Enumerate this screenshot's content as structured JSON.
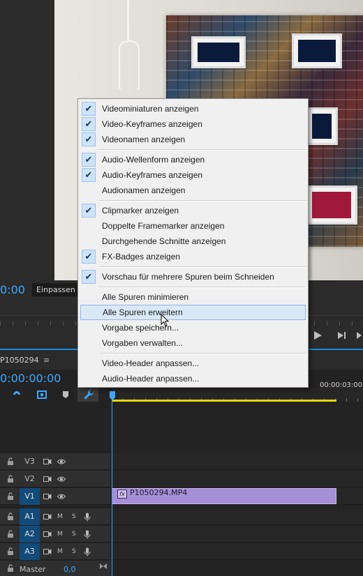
{
  "monitor": {
    "timecode": "0:00",
    "fit_label": "Einpassen"
  },
  "timeline": {
    "sequence_name": "P1050294",
    "sequence_menu_glyph": "≡",
    "timecode": "0:00:00:00",
    "ruler_end_label": "00:00:03:00",
    "tracks": {
      "video": [
        {
          "label": "V3",
          "active": false
        },
        {
          "label": "V2",
          "active": false
        },
        {
          "label": "V1",
          "active": true
        }
      ],
      "audio": [
        {
          "label": "A1",
          "m": "M",
          "s": "S",
          "active": true
        },
        {
          "label": "A2",
          "m": "M",
          "s": "S",
          "active": true
        },
        {
          "label": "A3",
          "m": "M",
          "s": "S",
          "active": true
        }
      ]
    },
    "clip": {
      "name": "P1050294.MP4",
      "fx_badge": "fx",
      "color": "#a58fd6"
    },
    "master": {
      "label": "Master",
      "value": "0,0"
    }
  },
  "context_menu": {
    "items": [
      {
        "label": "Videominiaturen anzeigen",
        "checked": true
      },
      {
        "label": "Video-Keyframes anzeigen",
        "checked": true
      },
      {
        "label": "Videonamen anzeigen",
        "checked": true
      },
      {
        "label": "Audio-Wellenform anzeigen",
        "checked": true
      },
      {
        "label": "Audio-Keyframes anzeigen",
        "checked": true
      },
      {
        "label": "Audionamen anzeigen",
        "checked": false
      },
      {
        "label": "Clipmarker anzeigen",
        "checked": true
      },
      {
        "label": "Doppelte Framemarker anzeigen",
        "checked": false
      },
      {
        "label": "Durchgehende Schnitte anzeigen",
        "checked": false
      },
      {
        "label": "FX-Badges anzeigen",
        "checked": true
      },
      {
        "label": "Vorschau für mehrere Spuren beim Schneiden",
        "checked": true
      },
      {
        "label": "Alle Spuren minimieren",
        "checked": false
      },
      {
        "label": "Alle Spuren erweitern",
        "checked": false,
        "hovered": true
      },
      {
        "label": "Vorgabe speichern...",
        "checked": false
      },
      {
        "label": "Vorgaben verwalten...",
        "checked": false
      },
      {
        "label": "Video-Header anpassen...",
        "checked": false
      },
      {
        "label": "Audio-Header anpassen...",
        "checked": false
      }
    ],
    "check_glyph": "✔"
  },
  "colors": {
    "accent": "#3ea7ff",
    "work_area": "#e8d60a",
    "track_target_active": "#124a7a"
  }
}
